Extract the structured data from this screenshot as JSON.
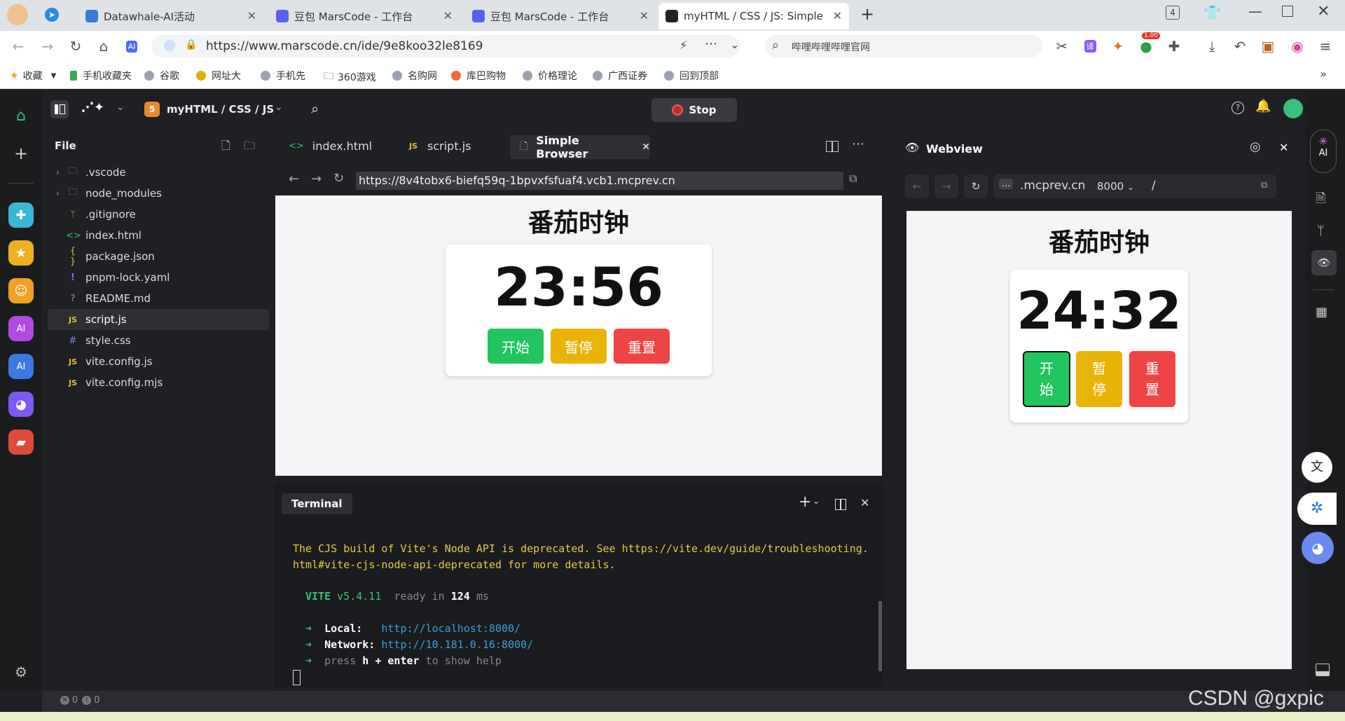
{
  "browser_tabs": [
    {
      "label": "Datawhale-AI活动"
    },
    {
      "label": "豆包 MarsCode - 工作台"
    },
    {
      "label": "豆包 MarsCode - 工作台"
    },
    {
      "label": "myHTML / CSS / JS: Simple"
    }
  ],
  "tab_count": "4",
  "address": {
    "url": "https://www.marscode.cn/ide/9e8koo32le8169"
  },
  "search_box": {
    "placeholder": "哔哩哔哩哔哩官网"
  },
  "badge_count": "1.00",
  "bookmarks": [
    "收藏",
    "手机收藏夹",
    "谷歌",
    "网址大",
    "手机先",
    "360游戏",
    "名购网",
    "库巴购物",
    "价格理论",
    "广西证券",
    "回到顶部"
  ],
  "project": {
    "name": "myHTML / CSS / JS"
  },
  "stop_label": "Stop",
  "explorer": {
    "title": "File",
    "items": [
      {
        "name": ".vscode",
        "icon": "folder"
      },
      {
        "name": "node_modules",
        "icon": "folder"
      },
      {
        "name": ".gitignore",
        "icon": "git"
      },
      {
        "name": "index.html",
        "icon": "html"
      },
      {
        "name": "package.json",
        "icon": "{}"
      },
      {
        "name": "pnpm-lock.yaml",
        "icon": "!"
      },
      {
        "name": "README.md",
        "icon": "?"
      },
      {
        "name": "script.js",
        "icon": "JS"
      },
      {
        "name": "style.css",
        "icon": "#"
      },
      {
        "name": "vite.config.js",
        "icon": "JS"
      },
      {
        "name": "vite.config.mjs",
        "icon": "JS"
      }
    ]
  },
  "editor_tabs": [
    {
      "label": "index.html",
      "icon": "<>"
    },
    {
      "label": "script.js",
      "icon": "JS"
    },
    {
      "label": "Simple Browser",
      "icon": "doc"
    }
  ],
  "simple_browser": {
    "url": "https://8v4tobx6-biefq59q-1bpvxfsfuaf4.vcb1.mcprev.cn",
    "title": "番茄时钟",
    "time": "23:56",
    "start": "开始",
    "pause": "暂停",
    "reset": "重置"
  },
  "webview": {
    "title": "Webview",
    "host": ".mcprev.cn",
    "ellipsis": "...",
    "port": "8000",
    "path": "/",
    "page_title": "番茄时钟",
    "time": "24:32",
    "start": "开始",
    "pause": "暂停",
    "reset": "重置"
  },
  "terminal": {
    "tab": "Terminal",
    "warn1": "The CJS build of Vite's Node API is deprecated. See https://vite.dev/guide/troubleshooting.",
    "warn2": "html#vite-cjs-node-api-deprecated for more details.",
    "vite": "VITE",
    "version": "v5.4.11",
    "ready": "ready in",
    "ms_val": "124",
    "ms": "ms",
    "local_label": "Local:",
    "local_url": "http://localhost:8000/",
    "network_label": "Network:",
    "network_url": "http://10.181.0.16:8000/",
    "help_pre": "press",
    "help_key": "h + enter",
    "help_post": "to show help"
  },
  "status": {
    "errors": "0",
    "warnings": "0"
  },
  "watermark": "CSDN @gxpic",
  "right_ai_label": "AI"
}
